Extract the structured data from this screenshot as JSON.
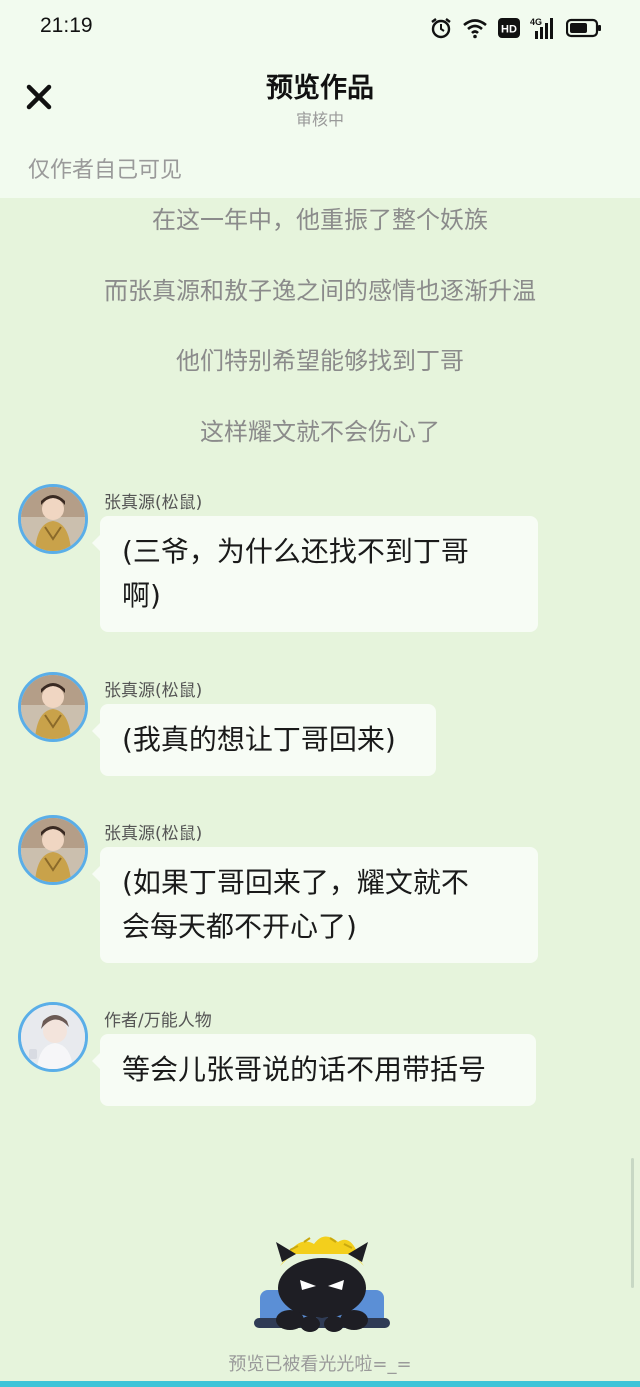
{
  "status": {
    "time": "21:19",
    "icons": [
      "alarm-icon",
      "wifi-icon",
      "hd-icon",
      "signal-4g-icon",
      "battery-icon"
    ],
    "hd_label": "HD",
    "network_label": "4G"
  },
  "header": {
    "title": "预览作品",
    "subtitle": "审核中",
    "visibility": "仅作者自己可见",
    "close_icon": "close-icon"
  },
  "narration": [
    "在这一年中，他重振了整个妖族",
    "而张真源和敖子逸之间的感情也逐渐升温",
    "他们特别希望能够找到丁哥",
    "这样耀文就不会伤心了"
  ],
  "messages": [
    {
      "name": "张真源(松鼠)",
      "lines": [
        "(三爷，为什么还找不到丁哥",
        "啊)"
      ]
    },
    {
      "name": "张真源(松鼠)",
      "lines": [
        "(我真的想让丁哥回来)"
      ]
    },
    {
      "name": "张真源(松鼠)",
      "lines": [
        "(如果丁哥回来了，耀文就不",
        "会每天都不开心了)"
      ]
    },
    {
      "name": "作者/万能人物",
      "lines": [
        "等会儿张哥说的话不用带括号"
      ]
    }
  ],
  "footer": {
    "text": "预览已被看光光啦=_="
  },
  "colors": {
    "background": "#e6f4dc",
    "header": "#f2fbef",
    "bubble": "#f7fcf5",
    "avatar_border": "#5aaee8",
    "accent_line": "#3cc4d8"
  }
}
